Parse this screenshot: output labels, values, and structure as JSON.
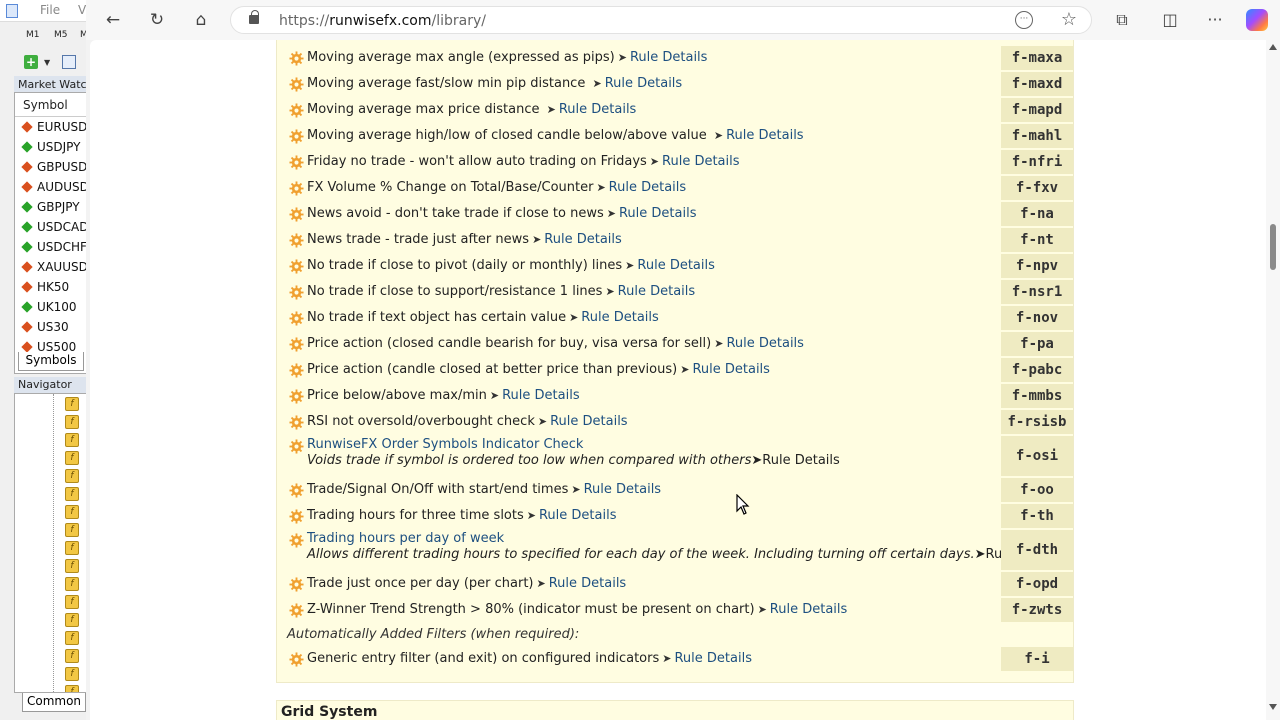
{
  "mt4": {
    "menu": [
      "File",
      "V"
    ],
    "timeframes": [
      "M1",
      "M5",
      "M"
    ],
    "market_watch_title": "Market Watch",
    "symbol_header": "Symbol",
    "symbols": [
      {
        "name": "EURUSD",
        "dir": "down"
      },
      {
        "name": "USDJPY",
        "dir": "up"
      },
      {
        "name": "GBPUSD",
        "dir": "down"
      },
      {
        "name": "AUDUSD",
        "dir": "down"
      },
      {
        "name": "GBPJPY",
        "dir": "up"
      },
      {
        "name": "USDCAD",
        "dir": "up"
      },
      {
        "name": "USDCHF",
        "dir": "up"
      },
      {
        "name": "XAUUSD",
        "dir": "down"
      },
      {
        "name": "HK50",
        "dir": "down"
      },
      {
        "name": "UK100",
        "dir": "up"
      },
      {
        "name": "US30",
        "dir": "down"
      },
      {
        "name": "US500",
        "dir": "down"
      }
    ],
    "symbols_tab": "Symbols",
    "navigator_title": "Navigator",
    "common_tab": "Common"
  },
  "browser": {
    "url_prefix": "https://",
    "url_domain": "runwisefx.com",
    "url_path": "/library/"
  },
  "filters": [
    {
      "text": "Moving average max angle (expressed as pips)",
      "code": "f-maxa"
    },
    {
      "text": "Moving average fast/slow min pip distance ",
      "code": "f-maxd"
    },
    {
      "text": "Moving average max price distance ",
      "code": "f-mapd"
    },
    {
      "text": "Moving average high/low of closed candle below/above value ",
      "code": "f-mahl"
    },
    {
      "text": "Friday no trade - won't allow auto trading on Fridays",
      "code": "f-nfri"
    },
    {
      "text": "FX Volume % Change on Total/Base/Counter",
      "code": "f-fxv"
    },
    {
      "text": "News avoid - don't take trade if close to news",
      "code": "f-na"
    },
    {
      "text": "News trade - trade just after news",
      "code": "f-nt"
    },
    {
      "text": "No trade if close to pivot (daily or monthly) lines",
      "code": "f-npv"
    },
    {
      "text": "No trade if close to support/resistance 1 lines",
      "code": "f-nsr1"
    },
    {
      "text": "No trade if text object has certain value",
      "code": "f-nov"
    },
    {
      "text": "Price action (closed candle bearish for buy, visa versa for sell)",
      "code": "f-pa"
    },
    {
      "text": "Price action (candle closed at better price than previous)",
      "code": "f-pabc"
    },
    {
      "text": "Price below/above max/min",
      "code": "f-mmbs"
    },
    {
      "text": "RSI not oversold/overbought check",
      "code": "f-rsisb"
    },
    {
      "text": "RunwiseFX Order Symbols Indicator Check",
      "sub": "Voids trade if symbol is ordered too low when compared with others",
      "code": "f-osi"
    },
    {
      "text": "Trade/Signal On/Off with start/end times",
      "code": "f-oo"
    },
    {
      "text": "Trading hours for three time slots",
      "code": "f-th"
    },
    {
      "text": "Trading hours per day of week",
      "sub": "Allows different trading hours to specified for each day of the week. Including turning off certain days.",
      "code": "f-dth"
    },
    {
      "text": "Trade just once per day (per chart)",
      "code": "f-opd"
    },
    {
      "text": "Z-Winner Trend Strength > 80% (indicator must be present on chart)",
      "code": "f-zwts"
    }
  ],
  "rule_details_label": "Rule Details",
  "auto_filters_label": "Automatically Added Filters (when required):",
  "auto_filters": [
    {
      "text": "Generic entry filter (and exit) on configured indicators",
      "code": "f-i"
    }
  ],
  "next_section_title": "Grid System",
  "colors": {
    "page_bg": "#fffde1",
    "code_bg": "#efebc2",
    "link": "#1d4f80",
    "gear": "#f0a030"
  }
}
